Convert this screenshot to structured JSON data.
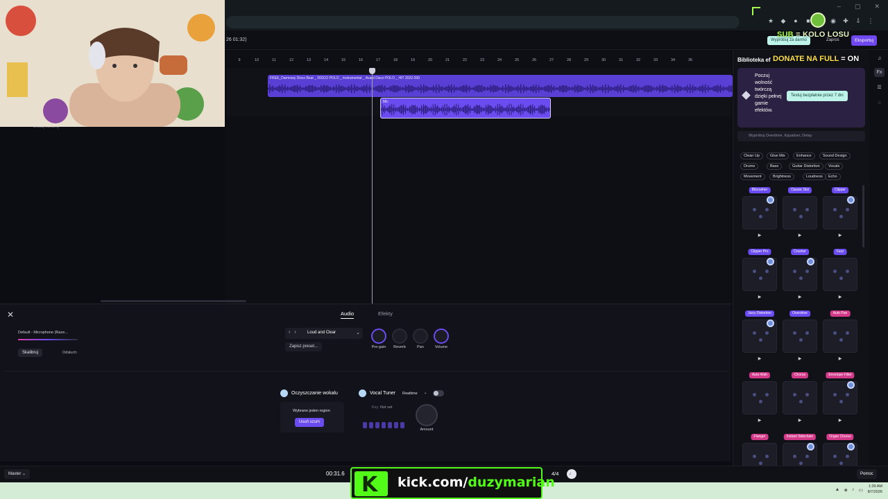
{
  "browser": {
    "icons": [
      "ext-icon",
      "ext-icon",
      "ext-icon",
      "ext-icon",
      "ext-icon",
      "ext-icon",
      "download-icon",
      "avatar"
    ],
    "window_controls": [
      "–",
      "▢",
      "✕"
    ]
  },
  "app": {
    "timecode_top": "26 01:32)",
    "try_free_label": "Wypróbuj za darmo",
    "invite_label": "Zaproś",
    "export_label": "Eksportuj"
  },
  "overlays": {
    "sub_prefix": "SUB",
    "sub_rest": " = KOLO LOSU",
    "donate_prefix": "DONATE NA FULL",
    "donate_rest": " = ON"
  },
  "timeline": {
    "ticks": [
      "9",
      "10",
      "11",
      "12",
      "13",
      "14",
      "15",
      "16",
      "17",
      "18",
      "19",
      "20",
      "21",
      "22",
      "23",
      "24",
      "25",
      "26",
      "27",
      "28",
      "29",
      "30",
      "31",
      "32",
      "33",
      "34",
      "35"
    ],
    "clip_main_label": "FREE_Darmowy Disco Beat _ DISCO POLO _ Instrumental _ Avard Disco POLO _ HIT 2022-200",
    "clip_vocal_label": "Mic",
    "add_track": "Dodaj ścieżkę"
  },
  "bottom": {
    "tabs": [
      "Audio",
      "Efekty"
    ],
    "input_device": "Default - Microphone (Raze...",
    "calibrate": "Skalibruj",
    "listen": "Odsłuch:",
    "preset_name": "Loud and Clear",
    "save_preset": "Zapisz preset...",
    "knobs": [
      "Pre-gain",
      "Reverb",
      "Pan",
      "Volume"
    ],
    "vocal_clean_title": "Oczyszczanie wokalu",
    "selected_region": "Wybrano jeden region",
    "remove_noise": "Usuń szum",
    "tuner_title": "Vocal Tuner",
    "tuner_mode": "Realtime",
    "key_label": "Key",
    "key_value": "Not set",
    "amount": "Amount"
  },
  "footer": {
    "master": "Master",
    "time": "00:31.6",
    "time_signature": "4/4",
    "help": "Pomoc"
  },
  "kick": {
    "domain": "kick.com/",
    "channel": "duzymarian"
  },
  "taskbar": {
    "time": "1:39 AM",
    "date": "8/7/2026"
  },
  "sidebar": {
    "title": "Biblioteka ef",
    "promo_text": "Poczuj wolność twórczą dzięki pełnej gamie efektów.",
    "promo_button": "Testuj bezpłatnie przez 7 dni",
    "search_placeholder": "Wypróbuj Overdrive, Equalizer, Delay",
    "chips": [
      "Clean Up",
      "Glue Mix",
      "Enhance",
      "Sound Design",
      "Drums",
      "Bass",
      "Guitar Distortion",
      "Vocals",
      "Movement",
      "Brightness",
      "Loudness",
      "Echo"
    ],
    "effects": [
      {
        "name": "Bitcrusher",
        "color": "#6b4cf0"
      },
      {
        "name": "Classic Dist",
        "color": "#6b4cf0"
      },
      {
        "name": "Clipper",
        "color": "#6b4cf0"
      },
      {
        "name": "Clipper Pro",
        "color": "#6b4cf0"
      },
      {
        "name": "Crusher",
        "color": "#6b4cf0"
      },
      {
        "name": "Fuzz",
        "color": "#6b4cf0"
      },
      {
        "name": "Juicy Distortion",
        "color": "#6b4cf0"
      },
      {
        "name": "Overdrive",
        "color": "#6b4cf0"
      },
      {
        "name": "Auto Pan",
        "color": "#d33a8a"
      },
      {
        "name": "Auto-Wah",
        "color": "#d33a8a"
      },
      {
        "name": "Chorus",
        "color": "#d33a8a"
      },
      {
        "name": "Envelope Filter",
        "color": "#d33a8a"
      },
      {
        "name": "Flanger",
        "color": "#d33a8a"
      },
      {
        "name": "Instant Sidechain",
        "color": "#d33a8a"
      },
      {
        "name": "Organ Chorus",
        "color": "#d33a8a"
      }
    ]
  },
  "colors": {
    "accent": "#6b4cf0",
    "kick_green": "#53fc18",
    "mint": "#bdf3e8"
  }
}
